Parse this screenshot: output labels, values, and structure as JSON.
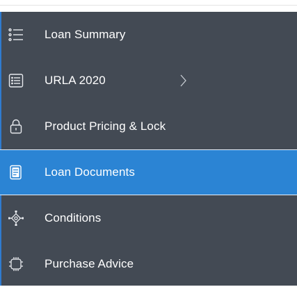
{
  "sidebar": {
    "items": [
      {
        "label": "Loan Summary",
        "icon": "list-icon",
        "active": false
      },
      {
        "label": "URLA 2020",
        "icon": "form-icon",
        "active": false,
        "has_submenu": true
      },
      {
        "label": "Product Pricing & Lock",
        "icon": "lock-icon",
        "active": false
      },
      {
        "label": "Loan Documents",
        "icon": "document-icon",
        "active": true
      },
      {
        "label": "Conditions",
        "icon": "conditions-icon",
        "active": false
      },
      {
        "label": "Purchase Advice",
        "icon": "chip-icon",
        "active": false
      }
    ]
  },
  "colors": {
    "sidebar_bg": "#434a54",
    "active_bg": "#2b84d4",
    "text": "#ffffff"
  }
}
